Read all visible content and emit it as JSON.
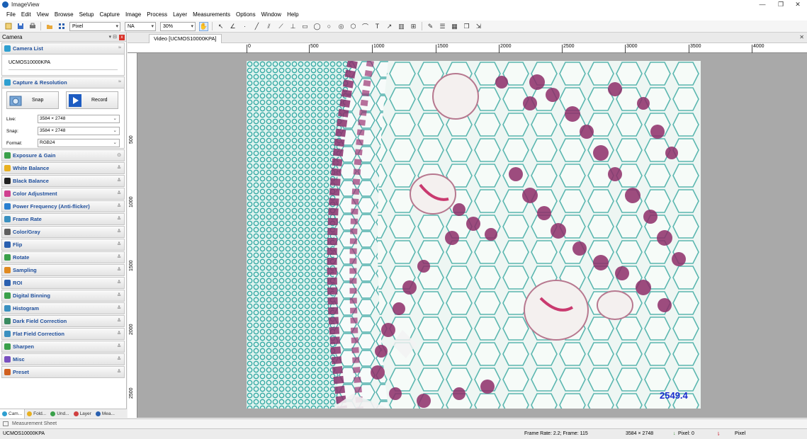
{
  "window": {
    "title": "ImageView",
    "controls": [
      "—",
      "❐",
      "✕"
    ]
  },
  "menu": [
    "File",
    "Edit",
    "View",
    "Browse",
    "Setup",
    "Capture",
    "Image",
    "Process",
    "Layer",
    "Measurements",
    "Options",
    "Window",
    "Help"
  ],
  "toolbar": {
    "unit_value": "Pixel",
    "na_value": "NA",
    "zoom_value": "30%"
  },
  "left_panel": {
    "title": "Camera",
    "camera_list": {
      "label": "Camera List",
      "camera_name": "UCMOS10000KPA"
    },
    "capture": {
      "label": "Capture & Resolution",
      "snap_label": "Snap",
      "record_label": "Record",
      "live_label": "Live:",
      "live_value": "3584 × 2748",
      "snap_res_label": "Snap:",
      "snap_value": "3584 × 2748",
      "format_label": "Format:",
      "format_value": "RGB24"
    },
    "sections": [
      {
        "label": "Exposure & Gain",
        "icon_color": "#3aa04a"
      },
      {
        "label": "White Balance",
        "icon_color": "#e8b020"
      },
      {
        "label": "Black Balance",
        "icon_color": "#222222"
      },
      {
        "label": "Color Adjustment",
        "icon_color": "#d04090"
      },
      {
        "label": "Power Frequency (Anti-flicker)",
        "icon_color": "#2a7fd0"
      },
      {
        "label": "Frame Rate",
        "icon_color": "#3a90c0"
      },
      {
        "label": "Color/Gray",
        "icon_color": "#606060"
      },
      {
        "label": "Flip",
        "icon_color": "#2a60b0"
      },
      {
        "label": "Rotate",
        "icon_color": "#3aa04a"
      },
      {
        "label": "Sampling",
        "icon_color": "#e08a20"
      },
      {
        "label": "ROI",
        "icon_color": "#2a60b0"
      },
      {
        "label": "Digital Binning",
        "icon_color": "#3aa04a"
      },
      {
        "label": "Histogram",
        "icon_color": "#3a90c0"
      },
      {
        "label": "Dark Field Correction",
        "icon_color": "#3a8a60"
      },
      {
        "label": "Flat Field Correction",
        "icon_color": "#3a90c0"
      },
      {
        "label": "Sharpen",
        "icon_color": "#3aa04a"
      },
      {
        "label": "Misc",
        "icon_color": "#7a50c0"
      },
      {
        "label": "Preset",
        "icon_color": "#d06020"
      }
    ],
    "bottom_tabs": [
      "Cam...",
      "Fold...",
      "Und...",
      "Layer",
      "Mea..."
    ]
  },
  "document": {
    "tab_label": "Video [UCMOS10000KPA]",
    "hruler_labels": [
      "0",
      "500",
      "1000",
      "1500",
      "2000",
      "2500",
      "3000",
      "3500",
      "4000"
    ],
    "vruler_labels": [
      "500",
      "1000",
      "1500",
      "2000",
      "2500"
    ],
    "overlay_value": "2549.4"
  },
  "measurement_sheet": {
    "label": "Measurement Sheet"
  },
  "status": {
    "camera": "UCMOS10000KPA",
    "frame": "Frame Rate: 2.2; Frame: 115",
    "resolution": "3584 × 2748",
    "pixel": "Pixel: 0",
    "unit": "Pixel"
  }
}
